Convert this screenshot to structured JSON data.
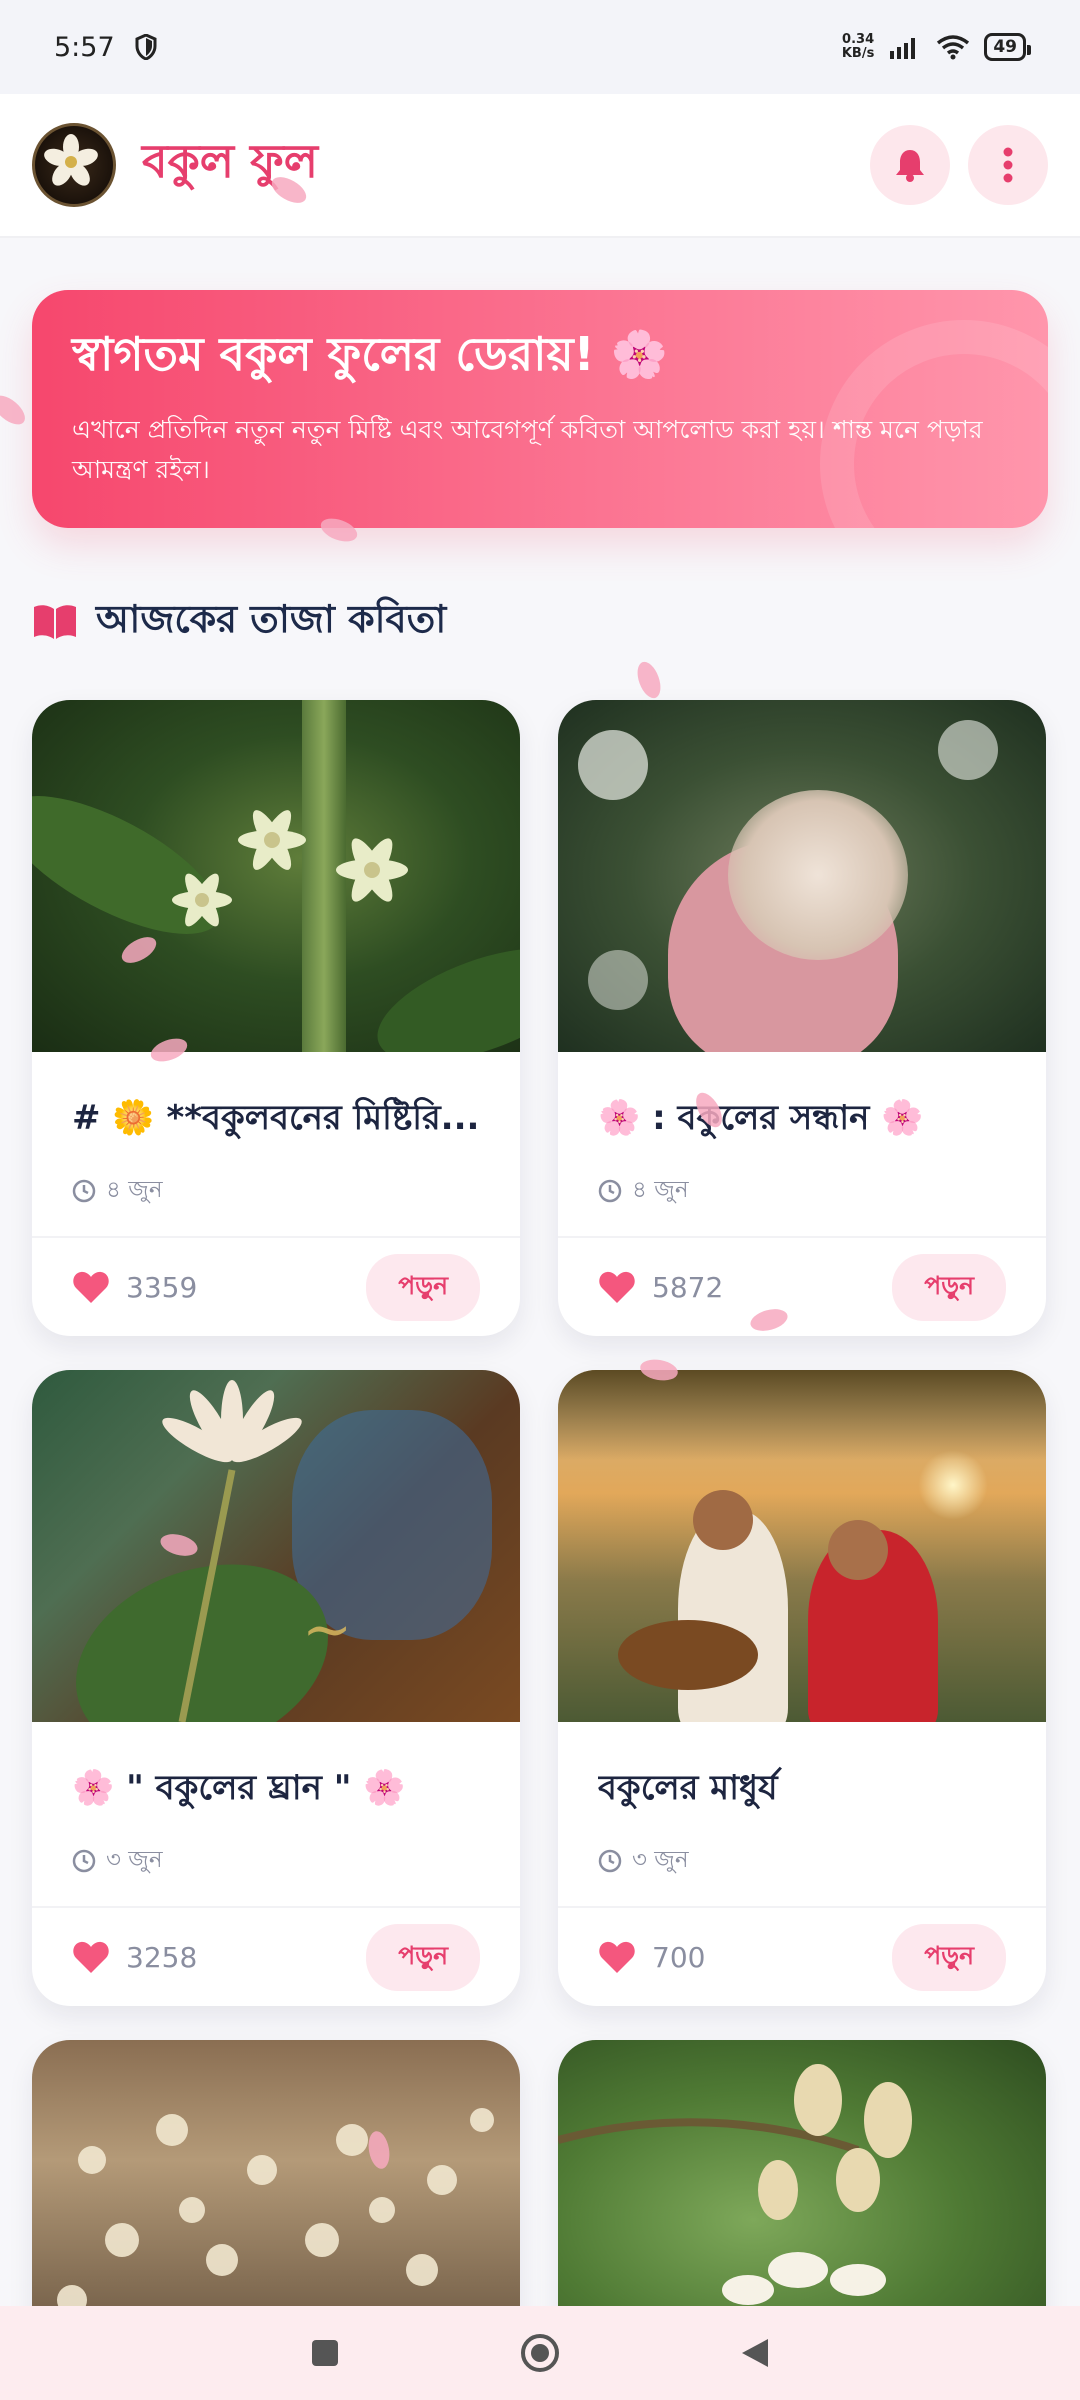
{
  "status_bar": {
    "time": "5:57",
    "net_speed_value": "0.34",
    "net_speed_unit": "KB/s",
    "battery": "49"
  },
  "app": {
    "title": "বকুল ফুল"
  },
  "banner": {
    "title": "স্বাগতম বকুল ফুলের ডেরায়! 🌸",
    "text": "এখানে প্রতিদিন নতুন নতুন মিষ্টি এবং আবেগপূর্ণ কবিতা আপলোড করা হয়। শান্ত মনে পড়ার আমন্ত্রণ রইল।"
  },
  "section": {
    "title": "আজকের তাজা কবিতা"
  },
  "cards": [
    {
      "title": "# 🌼 **বকুলবনের মিষ্টিরি...",
      "date": "৪ জুন",
      "likes": "3359",
      "read_label": "পড়ুন"
    },
    {
      "title": "🌸 : বকুলের সন্ধান 🌸",
      "date": "৪ জুন",
      "likes": "5872",
      "read_label": "পড়ুন"
    },
    {
      "title": "🌸 \" বকুলের ঘ্রান \" 🌸",
      "date": "৩ জুন",
      "likes": "3258",
      "read_label": "পড়ুন"
    },
    {
      "title": "বকুলের মাধুর্য",
      "date": "৩ জুন",
      "likes": "700",
      "read_label": "পড়ুন"
    }
  ],
  "colors": {
    "accent": "#e63e6d",
    "banner_start": "#f6476d",
    "banner_end": "#ff96ac",
    "nav_bg": "#fdecef"
  },
  "icons": {
    "notification": "bell-icon",
    "menu": "more-vertical-icon",
    "section": "book-icon",
    "date": "clock-icon",
    "likes": "heart-icon",
    "nav_recents": "square-icon",
    "nav_home": "circle-icon",
    "nav_back": "triangle-back-icon"
  }
}
